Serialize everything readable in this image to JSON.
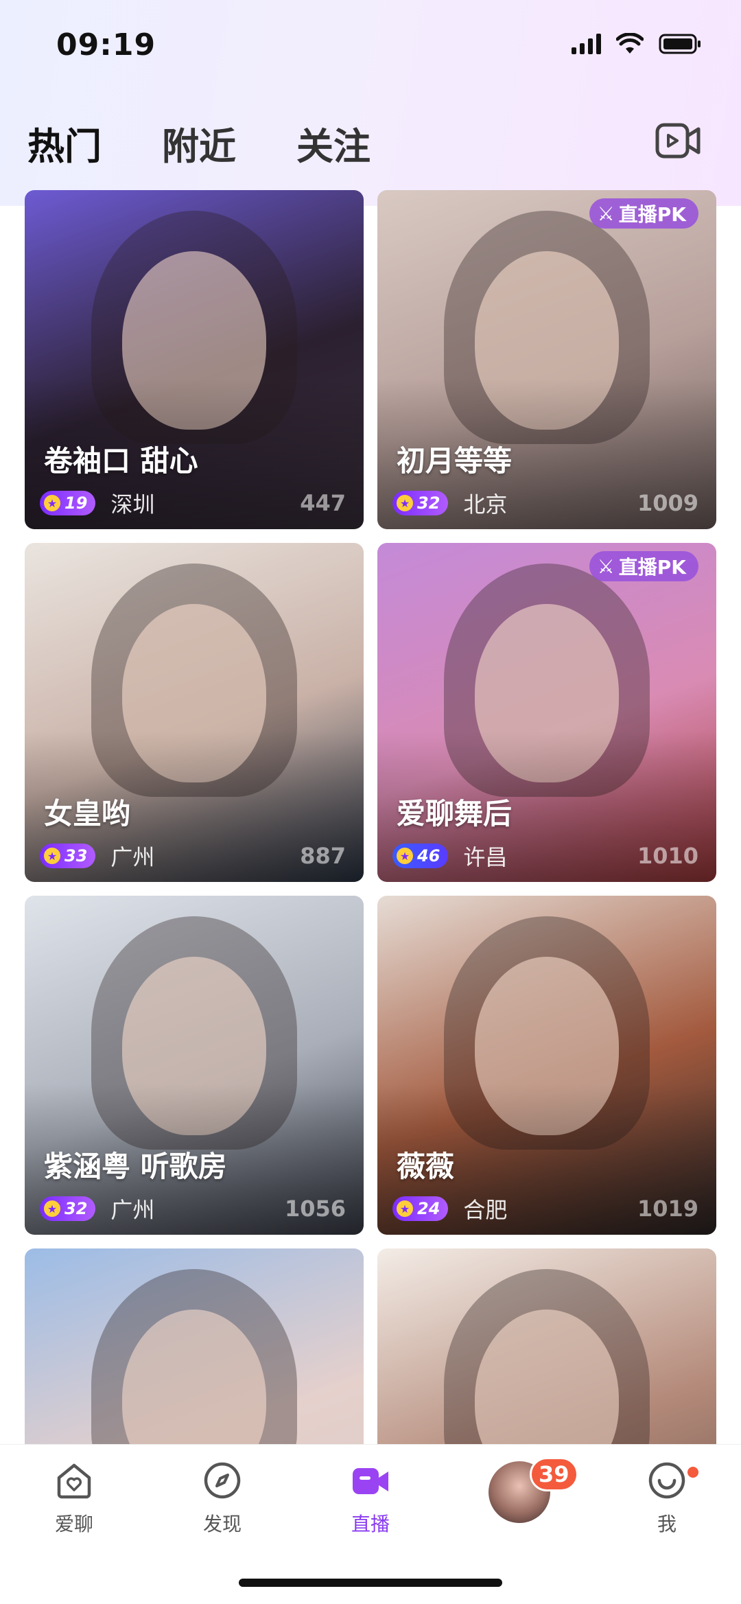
{
  "status_bar": {
    "time": "09:19"
  },
  "tabs": [
    {
      "label": "热门",
      "active": true
    },
    {
      "label": "附近",
      "active": false
    },
    {
      "label": "关注",
      "active": false
    }
  ],
  "cards": [
    {
      "title": "卷袖口 甜心",
      "level": "19",
      "city": "深圳",
      "count": "447",
      "pk": "",
      "bg": [
        "#6d5bd3",
        "#2b2030",
        "#3a2f3c"
      ]
    },
    {
      "title": "初月等等",
      "level": "32",
      "city": "北京",
      "count": "1009",
      "pk": "直播PK",
      "bg": [
        "#d9c9c3",
        "#b79f9a",
        "#6e5f5d"
      ]
    },
    {
      "title": "女皇哟",
      "level": "33",
      "city": "广州",
      "count": "887",
      "pk": "",
      "bg": [
        "#eae4df",
        "#c9b1a7",
        "#2a3443"
      ]
    },
    {
      "title": "爱聊舞后",
      "level": "46",
      "city": "许昌",
      "count": "1010",
      "pk": "直播PK",
      "bg": [
        "#c48ad8",
        "#d98bb3",
        "#a23a3a"
      ],
      "level_style": "blue"
    },
    {
      "title": "紫涵粤 听歌房",
      "level": "32",
      "city": "广州",
      "count": "1056",
      "pk": "",
      "bg": [
        "#dfe3ea",
        "#a9aeb8",
        "#3b3f4a"
      ]
    },
    {
      "title": "薇薇",
      "level": "24",
      "city": "合肥",
      "count": "1019",
      "pk": "",
      "bg": [
        "#e6dcd5",
        "#a35a3e",
        "#2c2626"
      ]
    },
    {
      "title": "",
      "level": "",
      "city": "",
      "count": "",
      "pk": "",
      "bg": [
        "#9cbce6",
        "#e5d0cc",
        "#d9c8c3"
      ]
    },
    {
      "title": "",
      "level": "",
      "city": "",
      "count": "",
      "pk": "",
      "bg": [
        "#f3ece6",
        "#b48a7a",
        "#6a5248"
      ]
    }
  ],
  "nav": [
    {
      "label": "爱聊",
      "icon": "heart-house-icon"
    },
    {
      "label": "发现",
      "icon": "compass-icon"
    },
    {
      "label": "直播",
      "icon": "live-camera-icon",
      "active": true
    },
    {
      "label": "",
      "icon": "avatar"
    },
    {
      "label": "我",
      "icon": "smile-icon"
    }
  ],
  "messages_badge": "39",
  "accent": "#8a3bf0"
}
